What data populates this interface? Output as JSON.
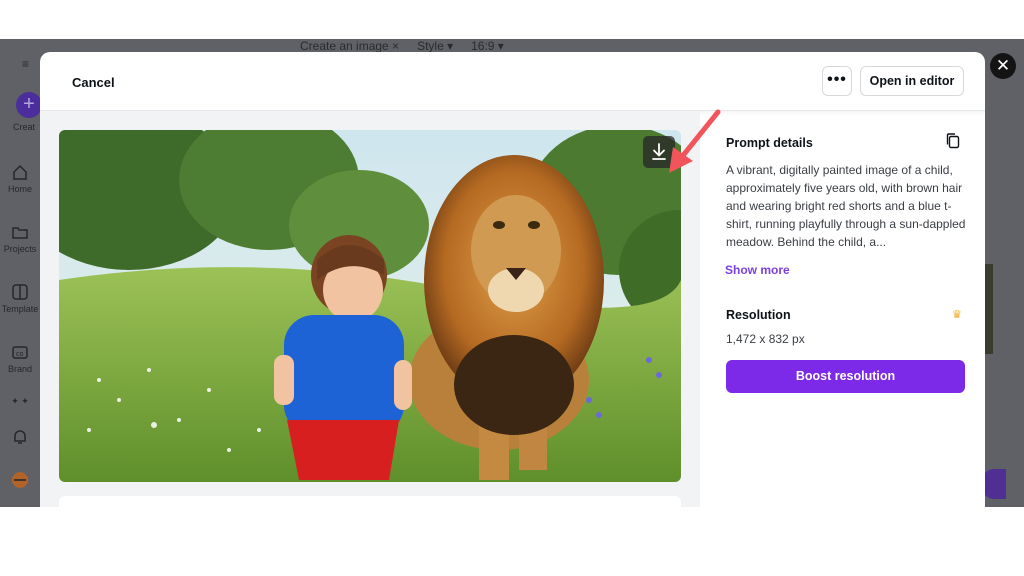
{
  "background_editor": {
    "top_items": [
      "Create an image ×",
      "Style ▾",
      "16:9 ▾"
    ],
    "create_label": "Creat",
    "sidebar": [
      {
        "label": "Home",
        "icon": "home-icon"
      },
      {
        "label": "Projects",
        "icon": "folder-icon"
      },
      {
        "label": "Template",
        "icon": "template-icon"
      },
      {
        "label": "Brand",
        "icon": "brand-icon"
      },
      {
        "label": "",
        "icon": "apps-icon"
      },
      {
        "label": "",
        "icon": "bell-icon"
      }
    ]
  },
  "modal": {
    "cancel_label": "Cancel",
    "more_label": "•••",
    "open_in_editor_label": "Open in editor",
    "close_label": "✕"
  },
  "image": {
    "description_icon": "download-icon",
    "annotation": "red-arrow pointing at download button"
  },
  "details": {
    "prompt_title": "Prompt details",
    "prompt_text": "A vibrant, digitally painted image of a child, approximately five years old, with brown hair and wearing bright red shorts and a blue t-shirt, running playfully through a sun-dappled meadow.  Behind the child, a...",
    "show_more_label": "Show more",
    "resolution_title": "Resolution",
    "resolution_value": "1,472 x 832 px",
    "boost_label": "Boost resolution"
  },
  "colors": {
    "accent": "#7d2ae8",
    "arrow": "#f2545b",
    "crown": "#f5a623"
  }
}
